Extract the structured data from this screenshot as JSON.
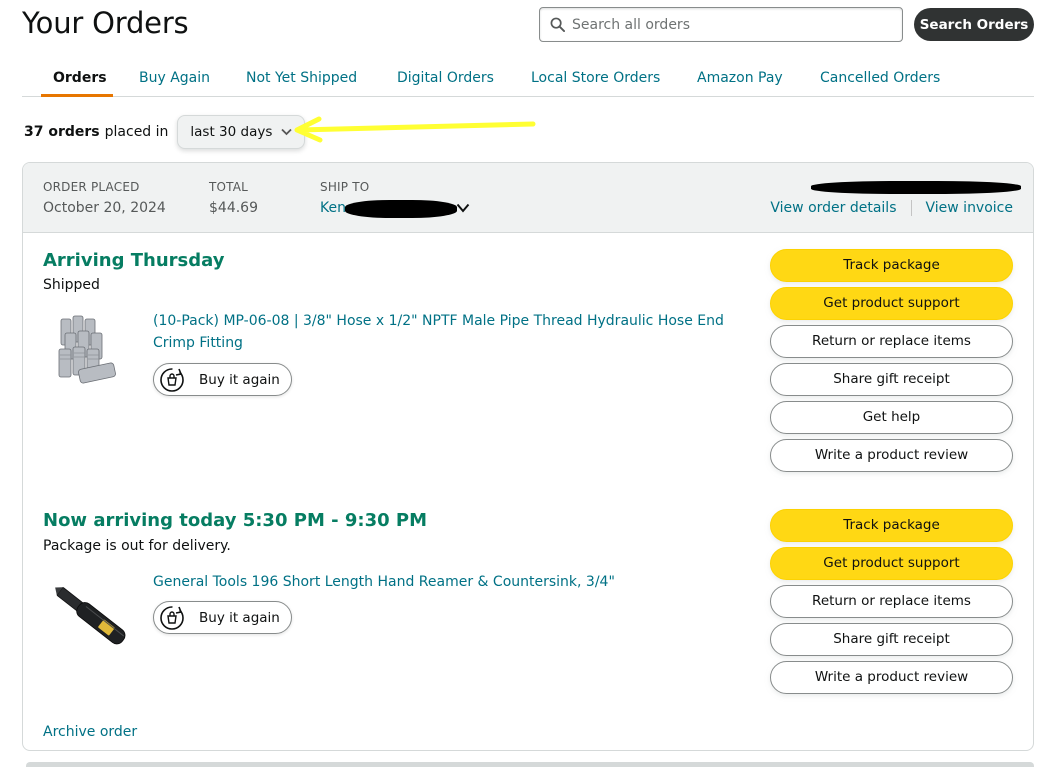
{
  "page": {
    "title": "Your Orders"
  },
  "search": {
    "placeholder": "Search all orders",
    "button_label": "Search Orders"
  },
  "tabs": [
    {
      "label": "Orders",
      "active": true
    },
    {
      "label": "Buy Again",
      "active": false
    },
    {
      "label": "Not Yet Shipped",
      "active": false
    },
    {
      "label": "Digital Orders",
      "active": false
    },
    {
      "label": "Local Store Orders",
      "active": false
    },
    {
      "label": "Amazon Pay",
      "active": false
    },
    {
      "label": "Cancelled Orders",
      "active": false
    }
  ],
  "filter": {
    "count_label": "37 orders",
    "placed_label": "placed in",
    "range_value": "last 30 days"
  },
  "order": {
    "placed_label": "ORDER PLACED",
    "placed_value": "October 20, 2024",
    "total_label": "TOTAL",
    "total_value": "$44.69",
    "ship_to_label": "SHIP TO",
    "ship_to_value": "Ken",
    "view_details_label": "View order details",
    "view_invoice_label": "View invoice",
    "shipments": [
      {
        "status_title": "Arriving Thursday",
        "status_sub": "Shipped",
        "product_title": "(10-Pack) MP-06-08 | 3/8\" Hose x 1/2\" NPTF Male Pipe Thread Hydraulic Hose End Crimp Fitting",
        "buy_again_label": "Buy it again",
        "actions": [
          {
            "label": "Track package",
            "style": "primary"
          },
          {
            "label": "Get product support",
            "style": "primary"
          },
          {
            "label": "Return or replace items",
            "style": "secondary"
          },
          {
            "label": "Share gift receipt",
            "style": "secondary"
          },
          {
            "label": "Get help",
            "style": "secondary"
          },
          {
            "label": "Write a product review",
            "style": "secondary"
          }
        ]
      },
      {
        "status_title": "Now arriving today 5:30 PM - 9:30 PM",
        "status_sub": "Package is out for delivery.",
        "product_title": "General Tools 196 Short Length Hand Reamer & Countersink, 3/4\"",
        "buy_again_label": "Buy it again",
        "actions": [
          {
            "label": "Track package",
            "style": "primary"
          },
          {
            "label": "Get product support",
            "style": "primary"
          },
          {
            "label": "Return or replace items",
            "style": "secondary"
          },
          {
            "label": "Share gift receipt",
            "style": "secondary"
          },
          {
            "label": "Write a product review",
            "style": "secondary"
          }
        ]
      }
    ],
    "archive_label": "Archive order"
  },
  "colors": {
    "link": "#007185",
    "status_green": "#067d62",
    "primary_button": "#ffd814",
    "tab_underline": "#e77600",
    "annotation_highlighter": "#ffff33",
    "redaction": "#000000"
  },
  "icons": [
    "search-icon",
    "chevron-down-icon",
    "buy-again-icon"
  ]
}
